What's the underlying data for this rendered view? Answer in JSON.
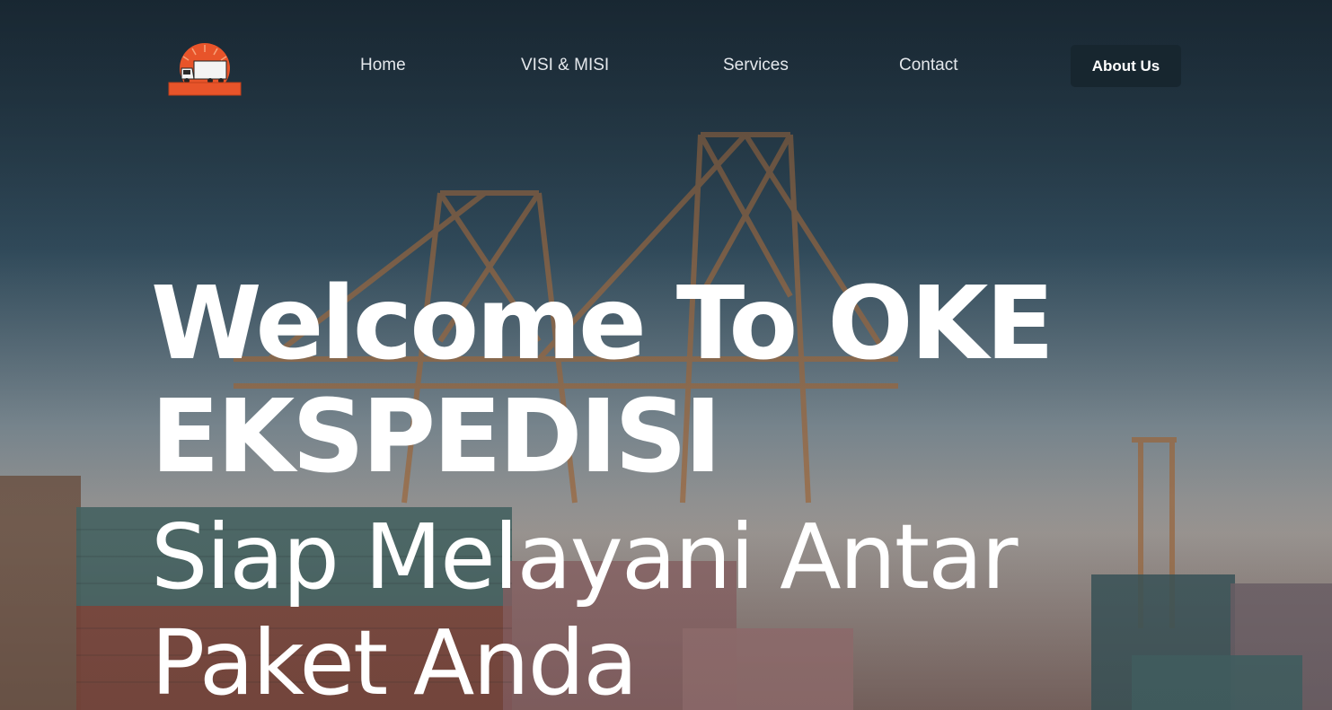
{
  "nav": {
    "logo_name": "truck-logo",
    "links": [
      {
        "label": "Home"
      },
      {
        "label": "VISI & MISI"
      },
      {
        "label": "Services"
      },
      {
        "label": "Contact"
      }
    ],
    "cta_label": "About Us"
  },
  "hero": {
    "headline": "Welcome To OKE EKSPEDISI",
    "subline": "Siap Melayani Antar Paket Anda"
  },
  "colors": {
    "brand_orange": "#e8542a",
    "cta_bg": "#17262f",
    "text": "#ffffff"
  }
}
